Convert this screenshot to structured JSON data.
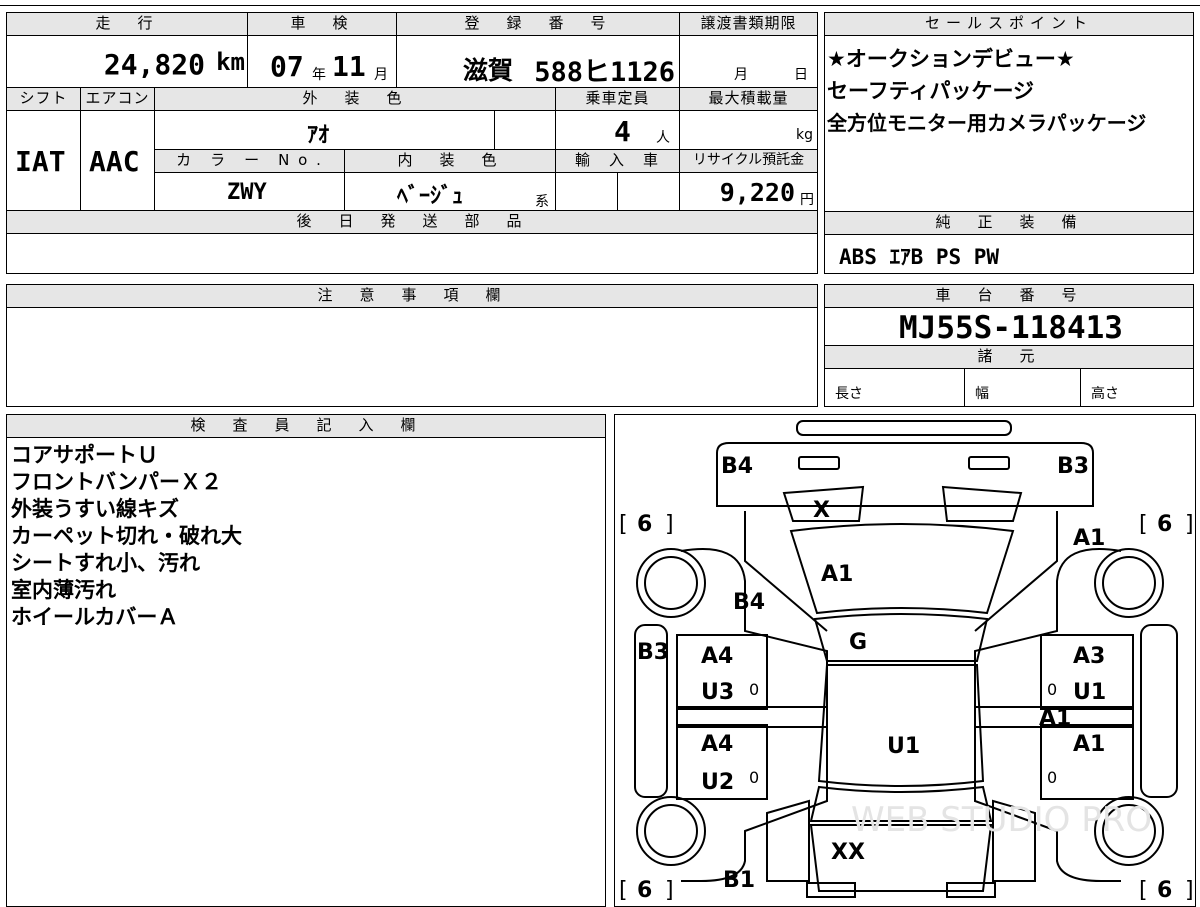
{
  "main_table": {
    "h_mileage": "走　行",
    "h_shaken": "車　検",
    "h_reg": "登　録　番　号",
    "h_transfer": "譲渡書類期限",
    "mileage": "24,820",
    "mileage_unit": "km",
    "shaken_year": "07",
    "shaken_year_unit": "年",
    "shaken_month": "11",
    "shaken_month_unit": "月",
    "reg_region": "滋賀",
    "reg_number": "588ヒ1126",
    "transfer_month": "月",
    "transfer_day": "日",
    "h_shift": "シフト",
    "h_aircon": "エアコン",
    "h_exterior": "外　装　色",
    "h_capacity": "乗車定員",
    "h_maxload": "最大積載量",
    "shift": "IAT",
    "aircon": "AAC",
    "exterior_color": "ｱｵ",
    "capacity": "4",
    "capacity_unit": "人",
    "maxload_unit": "kg",
    "h_colorno": "カ　ラ　ー　N o .",
    "h_interior": "内　装　色",
    "h_import": "輸　入　車",
    "h_recycle": "リサイクル預託金",
    "color_no": "ZWY",
    "interior_color": "ﾍﾞｰｼﾞｭ",
    "interior_suffix": "系",
    "recycle": "9,220",
    "recycle_unit": "円",
    "h_later_parts": "後　日　発　送　部　品"
  },
  "sales_points": {
    "header": "セールスポイント",
    "lines": [
      "★オークションデビュー★",
      "セーフティパッケージ",
      "全方位モニター用カメラパッケージ"
    ]
  },
  "genuine_equipment": {
    "header": "純　正　装　備",
    "items": "ABS ｴｱB PS PW"
  },
  "notes": {
    "header": "注　意　事　項　欄"
  },
  "chassis": {
    "header": "車　台　番　号",
    "number": "MJ55S-118413",
    "specs_header": "諸　元",
    "length": "長さ",
    "width": "幅",
    "height": "高さ"
  },
  "inspector": {
    "header": "検　査　員　記　入　欄",
    "lines": [
      "コアサポートＵ",
      "フロントバンパーＸ２",
      "外装うすい線キズ",
      "カーペット切れ・破れ大",
      "シートすれ小、汚れ",
      "室内薄汚れ",
      "ホイールカバーＡ"
    ]
  },
  "diagram": {
    "marks": {
      "b4_top": "B4",
      "b3_top": "B3",
      "x_windshield": "X",
      "a1_hood": "A1",
      "b4_fender": "B4",
      "a1_front_right": "A1",
      "g_windshield": "G",
      "b3_left": "B3",
      "a4_front_left_door": "A4",
      "u3": "U3",
      "a3_front_right_door": "A3",
      "u1_right": "U1",
      "a1_middle": "A1",
      "a4_rear_left_door": "A4",
      "u2": "U2",
      "a1_rear_right": "A1",
      "u1_roof": "U1",
      "xx_rear": "XX",
      "b1_rear": "B1"
    },
    "tire_labels": [
      "6",
      "6",
      "6",
      "6"
    ],
    "zero_marks": [
      "0",
      "0",
      "0",
      "0"
    ],
    "watermark": "WEB STUDIO PRO"
  }
}
